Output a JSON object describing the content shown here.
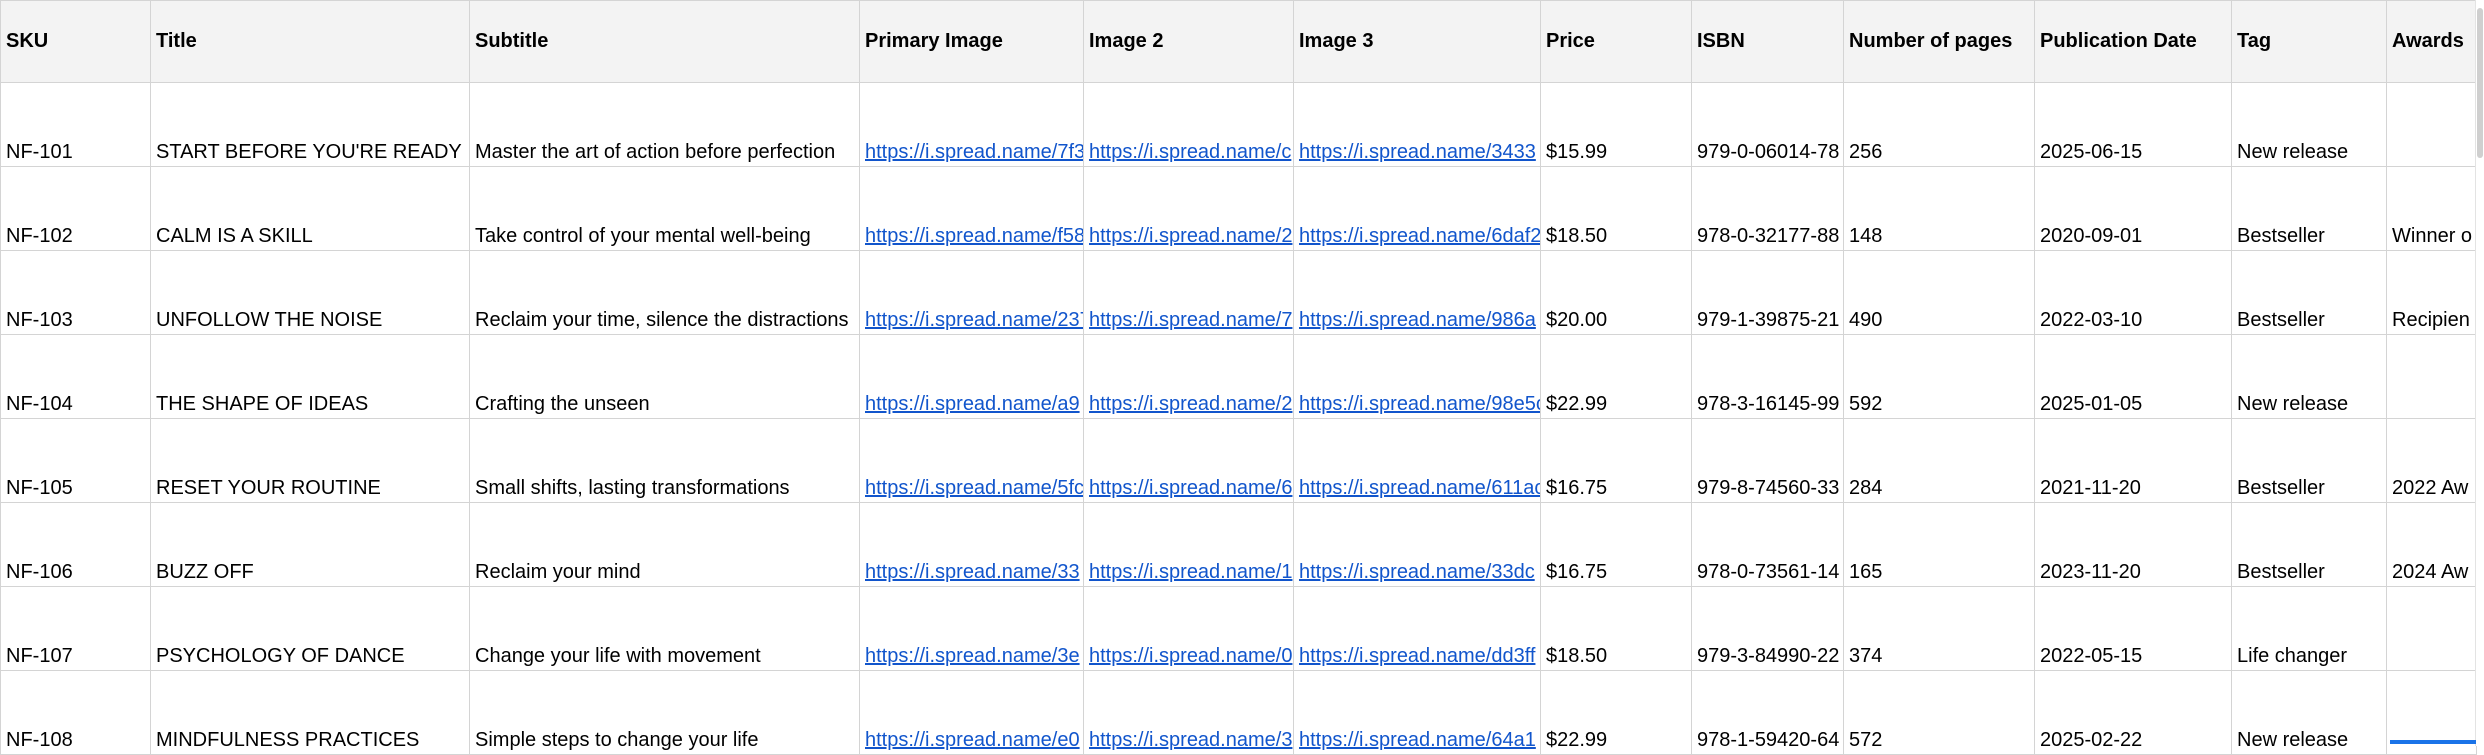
{
  "headers": [
    "SKU",
    "Title",
    "Subtitle",
    "Primary Image",
    "Image 2",
    "Image 3",
    "Price",
    "ISBN",
    "Number of pages",
    "Publication Date",
    "Tag",
    "Awards"
  ],
  "rows": [
    {
      "sku": "NF-101",
      "title": "START BEFORE YOU'RE READY",
      "subtitle": "Master the art of action before perfection",
      "img1": "https://i.spread.name/7f3",
      "img2": "https://i.spread.name/c",
      "img3": "https://i.spread.name/3433",
      "price": "$15.99",
      "isbn": "979-0-06014-78",
      "pages": "256",
      "date": "2025-06-15",
      "tag": "New release",
      "awards": ""
    },
    {
      "sku": "NF-102",
      "title": "CALM IS A SKILL",
      "subtitle": "Take control of your mental well-being",
      "img1": "https://i.spread.name/f58",
      "img2": "https://i.spread.name/2",
      "img3": "https://i.spread.name/6daf2",
      "price": "$18.50",
      "isbn": "978-0-32177-88",
      "pages": "148",
      "date": "2020-09-01",
      "tag": "Bestseller",
      "awards": "Winner o"
    },
    {
      "sku": "NF-103",
      "title": "UNFOLLOW THE NOISE",
      "subtitle": "Reclaim your time, silence the distractions",
      "img1": "https://i.spread.name/237",
      "img2": "https://i.spread.name/7",
      "img3": "https://i.spread.name/986a",
      "price": "$20.00",
      "isbn": "979-1-39875-21",
      "pages": "490",
      "date": "2022-03-10",
      "tag": "Bestseller",
      "awards": "Recipien"
    },
    {
      "sku": "NF-104",
      "title": "THE SHAPE OF IDEAS",
      "subtitle": "Crafting the unseen",
      "img1": "https://i.spread.name/a9",
      "img2": "https://i.spread.name/2",
      "img3": "https://i.spread.name/98e5c",
      "price": "$22.99",
      "isbn": "978-3-16145-99",
      "pages": "592",
      "date": "2025-01-05",
      "tag": "New release",
      "awards": ""
    },
    {
      "sku": "NF-105",
      "title": "RESET YOUR ROUTINE",
      "subtitle": "Small shifts, lasting transformations",
      "img1": "https://i.spread.name/5fc",
      "img2": "https://i.spread.name/6",
      "img3": "https://i.spread.name/611ac",
      "price": "$16.75",
      "isbn": "979-8-74560-33",
      "pages": "284",
      "date": "2021-11-20",
      "tag": "Bestseller",
      "awards": "2022 Aw"
    },
    {
      "sku": "NF-106",
      "title": "BUZZ OFF",
      "subtitle": "Reclaim your mind",
      "img1": "https://i.spread.name/33",
      "img2": "https://i.spread.name/1",
      "img3": "https://i.spread.name/33dc",
      "price": "$16.75",
      "isbn": "978-0-73561-14",
      "pages": "165",
      "date": "2023-11-20",
      "tag": "Bestseller",
      "awards": "2024 Aw"
    },
    {
      "sku": "NF-107",
      "title": "PSYCHOLOGY OF DANCE",
      "subtitle": "Change your life with movement",
      "img1": "https://i.spread.name/3e",
      "img2": "https://i.spread.name/0",
      "img3": "https://i.spread.name/dd3ff",
      "price": "$18.50",
      "isbn": "979-3-84990-22",
      "pages": "374",
      "date": "2022-05-15",
      "tag": "Life changer",
      "awards": ""
    },
    {
      "sku": "NF-108",
      "title": "MINDFULNESS PRACTICES",
      "subtitle": "Simple steps to change your life",
      "img1": "https://i.spread.name/e0",
      "img2": "https://i.spread.name/3",
      "img3": "https://i.spread.name/64a1",
      "price": "$22.99",
      "isbn": "978-1-59420-64",
      "pages": "572",
      "date": "2025-02-22",
      "tag": "New release",
      "awards": ""
    }
  ],
  "colors": {
    "header_bg": "#f3f3f3",
    "grid_line": "#d4d4d4",
    "link": "#1155cc",
    "selection": "#1a73e8"
  }
}
